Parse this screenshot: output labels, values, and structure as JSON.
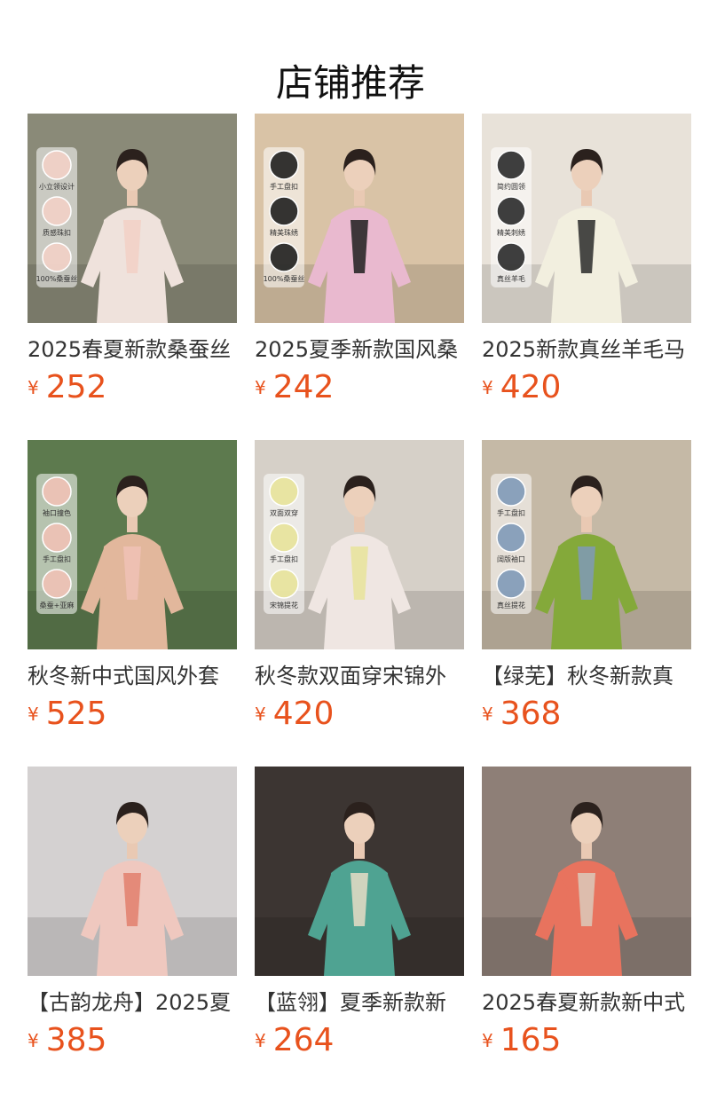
{
  "section_title": "店铺推荐",
  "currency_symbol": "¥",
  "products": [
    {
      "name": "2025春夏新款桑蚕丝",
      "price": "252",
      "feature_tags": [
        "小立领设计",
        "质感珠扣",
        "100%桑蚕丝"
      ],
      "bg": "#8a8a78",
      "garment": "#efe2dc",
      "accent": "#f2d0c6"
    },
    {
      "name": "2025夏季新款国风桑",
      "price": "242",
      "feature_tags": [
        "手工盘扣",
        "精美珠绣",
        "100%桑蚕丝"
      ],
      "bg": "#d9c3a6",
      "garment": "#e9b9cf",
      "accent": "#1f1f1f"
    },
    {
      "name": "2025新款真丝羊毛马",
      "price": "420",
      "feature_tags": [
        "简约圆领",
        "精美刺绣",
        "真丝羊毛"
      ],
      "bg": "#e8e2d9",
      "garment": "#f2efdf",
      "accent": "#2a2a2a"
    },
    {
      "name": "秋冬新中式国风外套",
      "price": "525",
      "feature_tags": [
        "袖口撞色",
        "手工盘扣",
        "桑蚕+亚麻"
      ],
      "bg": "#5d7a4e",
      "garment": "#e2b79c",
      "accent": "#f0c2b6"
    },
    {
      "name": "秋冬款双面穿宋锦外",
      "price": "420",
      "feature_tags": [
        "双面双穿",
        "手工盘扣",
        "宋锦提花"
      ],
      "bg": "#d6d0c8",
      "garment": "#efe6e2",
      "accent": "#e8e39a"
    },
    {
      "name": "【绿芜】秋冬新款真",
      "price": "368",
      "feature_tags": [
        "手工盘扣",
        "阔版袖口",
        "真丝提花"
      ],
      "bg": "#c5b9a6",
      "garment": "#84a93a",
      "accent": "#7f9ab8"
    },
    {
      "name": "【古韵龙舟】2025夏",
      "price": "385",
      "feature_tags": [],
      "bg": "#d4d1d1",
      "garment": "#efc8bf",
      "accent": "#e27f6c"
    },
    {
      "name": "【蓝翎】夏季新款新",
      "price": "264",
      "feature_tags": [],
      "bg": "#3c3532",
      "garment": "#4fa392",
      "accent": "#e6ddc6"
    },
    {
      "name": "2025春夏新款新中式",
      "price": "165",
      "feature_tags": [],
      "bg": "#8e7f77",
      "garment": "#e8735e",
      "accent": "#dbcabb"
    }
  ]
}
